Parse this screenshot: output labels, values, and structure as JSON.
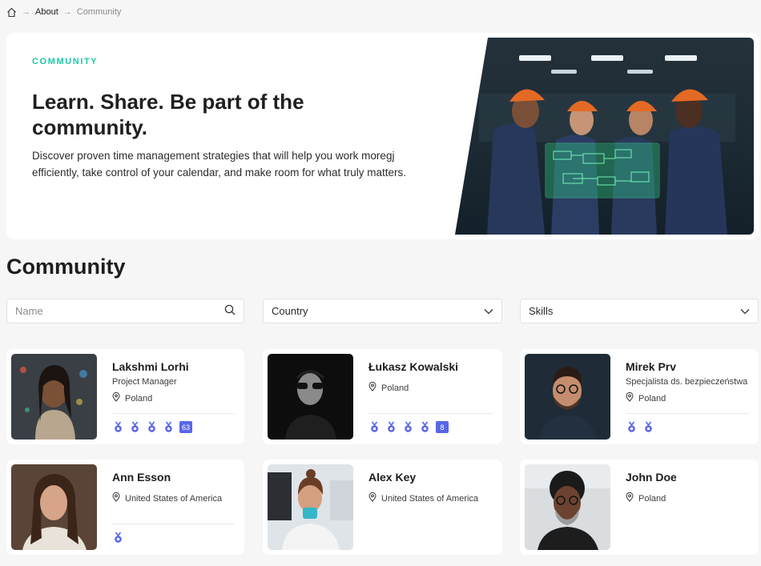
{
  "breadcrumb": {
    "items": [
      "About",
      "Community"
    ]
  },
  "hero": {
    "eyebrow": "COMMUNITY",
    "title": "Learn. Share. Be part of the community.",
    "description": "Discover proven time management strategies that will help you work moregj efficiently, take control of your calendar, and make room for what truly matters."
  },
  "section_title": "Community",
  "filters": {
    "name_placeholder": "Name",
    "country_label": "Country",
    "skills_label": "Skills"
  },
  "members": [
    {
      "name": "Lakshmi Lorhi",
      "role": "Project Manager",
      "country": "Poland",
      "medals": 4,
      "extra": "63"
    },
    {
      "name": "Łukasz Kowalski",
      "role": "",
      "country": "Poland",
      "medals": 4,
      "extra": "8"
    },
    {
      "name": "Mirek Prv",
      "role": "Specjalista ds. bezpieczeństwa",
      "country": "Poland",
      "medals": 2,
      "extra": ""
    },
    {
      "name": "Ann Esson",
      "role": "",
      "country": "United States of America",
      "medals": 1,
      "extra": ""
    },
    {
      "name": "Alex Key",
      "role": "",
      "country": "United States of America",
      "medals": 0,
      "extra": ""
    },
    {
      "name": "John Doe",
      "role": "",
      "country": "Poland",
      "medals": 0,
      "extra": ""
    }
  ],
  "colors": {
    "accent": "#1ec9a7",
    "medal": "#5867e8"
  },
  "icons": [
    "home-icon",
    "search-icon",
    "chevron-down-icon",
    "location-pin-icon",
    "medal-icon"
  ]
}
